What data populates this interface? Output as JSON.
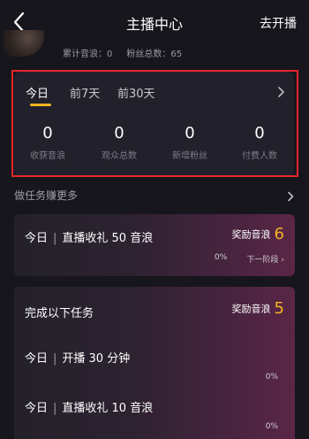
{
  "nav": {
    "title": "主播中心",
    "action": "去开播"
  },
  "profile": {
    "total_sound_waves": "累计音浪：0",
    "fans_total": "粉丝总数：65"
  },
  "tabs": [
    {
      "label": "今日"
    },
    {
      "label": "前7天"
    },
    {
      "label": "前30天"
    }
  ],
  "metrics": [
    {
      "value": "0",
      "label": "收获音浪"
    },
    {
      "value": "0",
      "label": "观众总数"
    },
    {
      "value": "0",
      "label": "新增粉丝"
    },
    {
      "value": "0",
      "label": "付费人数"
    }
  ],
  "section": {
    "title": "做任务赚更多"
  },
  "task1": {
    "prefix": "今日",
    "sep": "|",
    "name": "直播收礼 50 音浪",
    "reward_label": "奖励音浪",
    "reward_value": "6",
    "progress": "0%",
    "next": "下一阶段 ›"
  },
  "task2": {
    "title": "完成以下任务",
    "reward_label": "奖励音浪",
    "reward_value": "5",
    "subtasks": [
      {
        "prefix": "今日",
        "sep": "|",
        "name": "开播 30 分钟",
        "progress": "0%"
      },
      {
        "prefix": "今日",
        "sep": "|",
        "name": "直播收礼 10 音浪",
        "progress": "0%"
      }
    ]
  },
  "colors": {
    "accent": "#f5b323",
    "highlight_box": "#e4272a",
    "background": "#17161d"
  },
  "icons": {
    "back": "chevron-left-icon",
    "more": "chevron-right-icon"
  }
}
